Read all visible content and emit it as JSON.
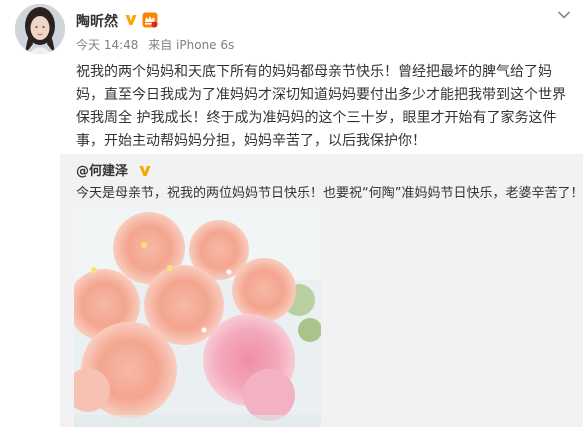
{
  "post": {
    "author": "陶昕然",
    "verified_icon": "verified-v-badge",
    "member_icon": "vip-member-crown-icon",
    "menu_icon": "chevron-down-icon",
    "time": "今天 14:48",
    "source": "来自 iPhone 6s",
    "text": "祝我的两个妈妈和天底下所有的妈妈都母亲节快乐！曾经把最坏的脾气给了妈妈，直至今日我成为了准妈妈才深切知道妈妈要付出多少才能把我带到这个世界保我周全 护我成长！终于成为准妈妈的这个三十岁，眼里才开始有了家务这件事，开始主动帮妈妈分担，妈妈辛苦了，以后我保护你！"
  },
  "repost": {
    "author": "@何建泽",
    "verified_icon": "verified-v-badge",
    "text": "今天是母亲节，祝我的两位妈妈节日快乐！也要祝“何陶”准妈妈节日快乐，老婆辛苦了！",
    "image_icon": "carnation-bouquet-photo"
  },
  "colors": {
    "verified": "#f7a700",
    "meta": "#808080",
    "repost_bg": "#f2f2f5",
    "text": "#333333"
  }
}
